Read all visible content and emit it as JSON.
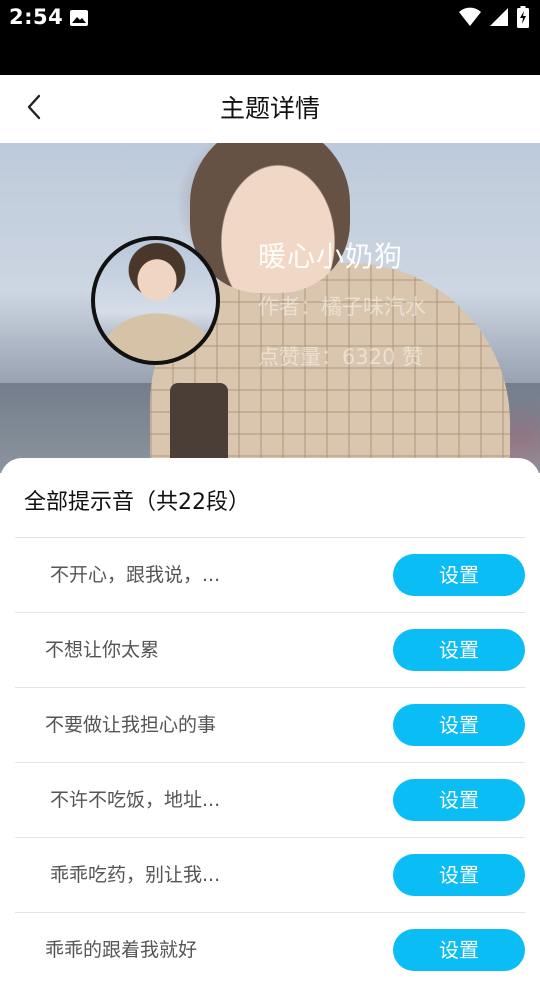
{
  "status_bar": {
    "time": "2:54"
  },
  "app_bar": {
    "title": "主题详情"
  },
  "hero": {
    "name": "暖心小奶狗",
    "author": "作者：橘子味汽水",
    "likes": "点赞量：6320 赞"
  },
  "sheet": {
    "title": "全部提示音（共22段）",
    "items": [
      {
        "text": "不开心，跟我说，...",
        "button": "设置"
      },
      {
        "text": "不想让你太累",
        "button": "设置"
      },
      {
        "text": "不要做让我担心的事",
        "button": "设置"
      },
      {
        "text": "不许不吃饭，地址...",
        "button": "设置"
      },
      {
        "text": "乖乖吃药，别让我...",
        "button": "设置"
      },
      {
        "text": "乖乖的跟着我就好",
        "button": "设置"
      }
    ]
  },
  "colors": {
    "accent": "#0bbdf5",
    "status_bar": "#000000"
  },
  "icons": {
    "back": "chevron-left-icon",
    "image": "image-icon",
    "wifi": "wifi-icon",
    "signal": "signal-icon",
    "battery": "battery-charging-icon"
  }
}
